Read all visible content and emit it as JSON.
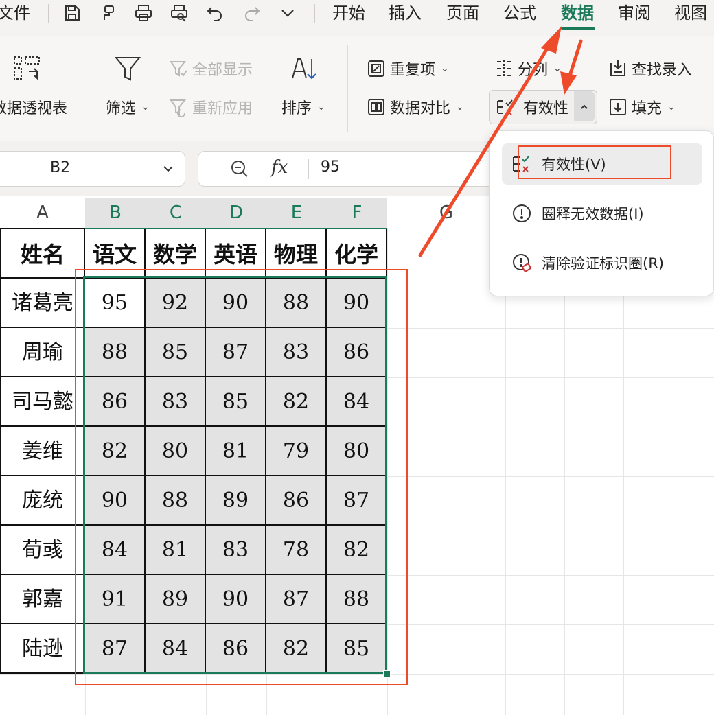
{
  "menu": {
    "file": "文件",
    "tabs": [
      "开始",
      "插入",
      "页面",
      "公式",
      "数据",
      "审阅",
      "视图"
    ],
    "active_tab": "数据"
  },
  "quick_access_icons": [
    "save-icon",
    "format-painter-icon",
    "print-icon",
    "print-preview-icon",
    "undo-icon",
    "redo-icon",
    "more-icon"
  ],
  "ribbon": {
    "pivot_table": "数据透视表",
    "filter": "筛选",
    "show_all": "全部显示",
    "reapply": "重新应用",
    "sort": "排序",
    "duplicates": "重复项",
    "split_column": "分列",
    "data_compare": "数据对比",
    "validity": "有效性",
    "find_entry": "查找录入",
    "fill": "填充"
  },
  "formula_bar": {
    "name_box": "B2",
    "fx": "fx",
    "value": "95"
  },
  "dropdown": {
    "items": [
      {
        "label": "有效性(V)",
        "icon": "validity-icon"
      },
      {
        "label": "圈释无效数据(I)",
        "icon": "circle-invalid-icon"
      },
      {
        "label": "清除验证标识圈(R)",
        "icon": "clear-circles-icon"
      }
    ]
  },
  "sheet": {
    "columns": [
      "A",
      "B",
      "C",
      "D",
      "E",
      "F",
      "G"
    ],
    "active_cell": "B2",
    "headers": [
      "姓名",
      "语文",
      "数学",
      "英语",
      "物理",
      "化学"
    ],
    "rows": [
      [
        "诸葛亮",
        "95",
        "92",
        "90",
        "88",
        "90"
      ],
      [
        "周瑜",
        "88",
        "85",
        "87",
        "83",
        "86"
      ],
      [
        "司马懿",
        "86",
        "83",
        "85",
        "82",
        "84"
      ],
      [
        "姜维",
        "82",
        "80",
        "81",
        "79",
        "80"
      ],
      [
        "庞统",
        "90",
        "88",
        "89",
        "86",
        "87"
      ],
      [
        "荀彧",
        "84",
        "81",
        "83",
        "78",
        "82"
      ],
      [
        "郭嘉",
        "91",
        "89",
        "90",
        "87",
        "88"
      ],
      [
        "陆逊",
        "87",
        "84",
        "86",
        "82",
        "85"
      ]
    ]
  },
  "colors": {
    "accent": "#1b7a5a",
    "annotation": "#ee4b2b",
    "selection_fill": "#e3e3e3"
  }
}
